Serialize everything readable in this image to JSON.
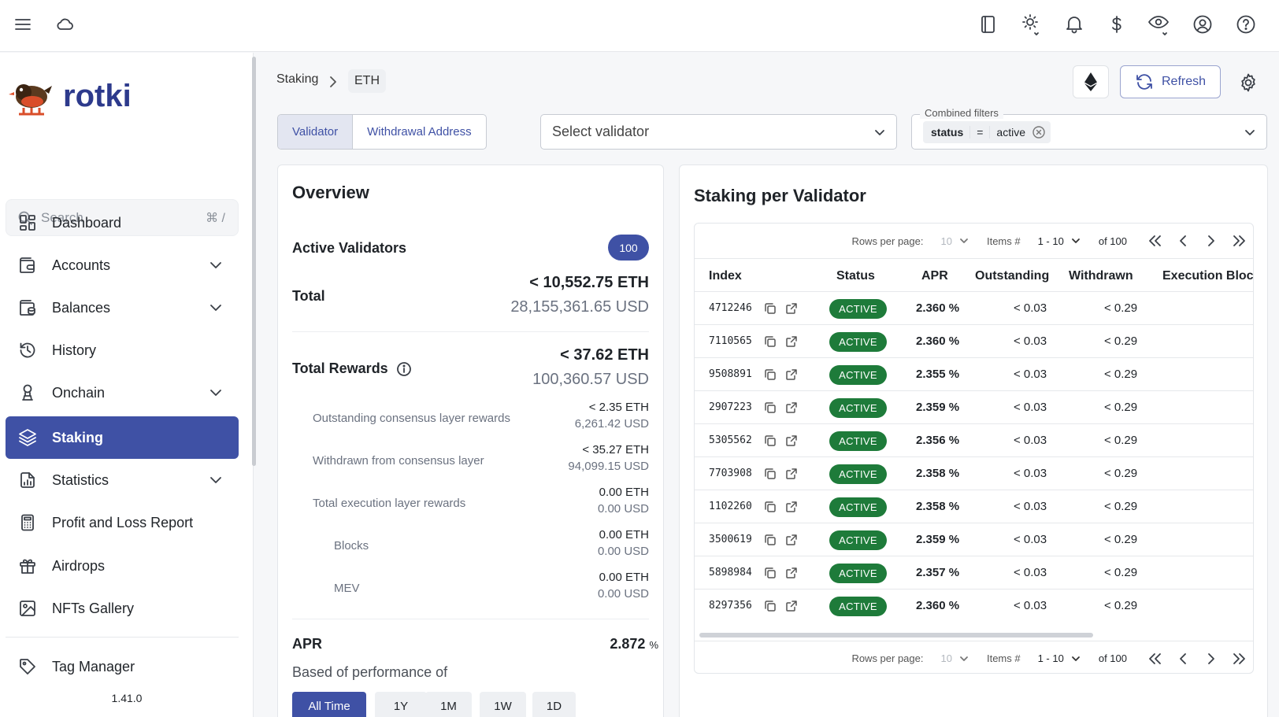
{
  "topbar": {
    "icons": [
      "menu-icon",
      "cloud-icon",
      "notes-icon",
      "theme-icon",
      "bell-icon",
      "dollar-icon",
      "eye-icon",
      "account-icon",
      "help-icon"
    ]
  },
  "sidebar": {
    "logo_text": "rotki",
    "search_placeholder": "Search",
    "search_shortcut": "⌘ /",
    "items": [
      {
        "label": "Dashboard",
        "icon": "dashboard-icon",
        "expandable": false
      },
      {
        "label": "Accounts",
        "icon": "wallet-icon",
        "expandable": true
      },
      {
        "label": "Balances",
        "icon": "balances-icon",
        "expandable": true
      },
      {
        "label": "History",
        "icon": "history-icon",
        "expandable": false
      },
      {
        "label": "Onchain",
        "icon": "onchain-icon",
        "expandable": true
      },
      {
        "label": "Staking",
        "icon": "stack-icon",
        "expandable": false,
        "active": true
      },
      {
        "label": "Statistics",
        "icon": "statistics-icon",
        "expandable": true
      },
      {
        "label": "Profit and Loss Report",
        "icon": "calculator-icon",
        "expandable": false
      },
      {
        "label": "Airdrops",
        "icon": "gift-icon",
        "expandable": false
      },
      {
        "label": "NFTs Gallery",
        "icon": "image-icon",
        "expandable": false
      }
    ],
    "tag_manager": "Tag Manager",
    "version": "1.41.0"
  },
  "header": {
    "breadcrumb": [
      "Staking",
      "ETH"
    ],
    "refresh_label": "Refresh"
  },
  "filters": {
    "toggle": [
      "Validator",
      "Withdrawal Address"
    ],
    "select_validator_placeholder": "Select validator",
    "combined_label": "Combined filters",
    "chip_key": "status",
    "chip_op": "=",
    "chip_value": "active"
  },
  "overview": {
    "title": "Overview",
    "active_validators_label": "Active Validators",
    "active_validators_count": "100",
    "total_label": "Total",
    "total_eth": "< 10,552.75 ETH",
    "total_usd": "28,155,361.65 USD",
    "rewards_label": "Total Rewards",
    "rewards_eth": "< 37.62 ETH",
    "rewards_usd": "100,360.57 USD",
    "breakdown": [
      {
        "label": "Outstanding consensus layer rewards",
        "eth": "< 2.35 ETH",
        "usd": "6,261.42 USD",
        "indent": 1
      },
      {
        "label": "Withdrawn from consensus layer",
        "eth": "< 35.27 ETH",
        "usd": "94,099.15 USD",
        "indent": 1
      },
      {
        "label": "Total execution layer rewards",
        "eth": "0.00 ETH",
        "usd": "0.00 USD",
        "indent": 1
      },
      {
        "label": "Blocks",
        "eth": "0.00 ETH",
        "usd": "0.00 USD",
        "indent": 2
      },
      {
        "label": "MEV",
        "eth": "0.00 ETH",
        "usd": "0.00 USD",
        "indent": 2
      }
    ],
    "apr_label": "APR",
    "apr_value": "2.872",
    "apr_unit": "%",
    "performance_label": "Based of performance of",
    "periods": [
      "All Time",
      "1Y",
      "1M",
      "1W",
      "1D"
    ],
    "selected_period": "All Time"
  },
  "validators": {
    "title": "Staking per Validator",
    "pager": {
      "rows_label": "Rows per page:",
      "rows_value": "10",
      "items_label": "Items #",
      "range": "1 - 10",
      "of_total": "of 100"
    },
    "columns": [
      "Index",
      "Status",
      "APR",
      "Outstanding",
      "Withdrawn",
      "Execution Block"
    ],
    "rows": [
      {
        "index": "4712246",
        "status": "ACTIVE",
        "apr": "2.360 %",
        "outstanding": "< 0.03",
        "withdrawn": "< 0.29"
      },
      {
        "index": "7110565",
        "status": "ACTIVE",
        "apr": "2.360 %",
        "outstanding": "< 0.03",
        "withdrawn": "< 0.29"
      },
      {
        "index": "9508891",
        "status": "ACTIVE",
        "apr": "2.355 %",
        "outstanding": "< 0.03",
        "withdrawn": "< 0.29"
      },
      {
        "index": "2907223",
        "status": "ACTIVE",
        "apr": "2.359 %",
        "outstanding": "< 0.03",
        "withdrawn": "< 0.29"
      },
      {
        "index": "5305562",
        "status": "ACTIVE",
        "apr": "2.356 %",
        "outstanding": "< 0.03",
        "withdrawn": "< 0.29"
      },
      {
        "index": "7703908",
        "status": "ACTIVE",
        "apr": "2.358 %",
        "outstanding": "< 0.03",
        "withdrawn": "< 0.29"
      },
      {
        "index": "1102260",
        "status": "ACTIVE",
        "apr": "2.358 %",
        "outstanding": "< 0.03",
        "withdrawn": "< 0.29"
      },
      {
        "index": "3500619",
        "status": "ACTIVE",
        "apr": "2.359 %",
        "outstanding": "< 0.03",
        "withdrawn": "< 0.29"
      },
      {
        "index": "5898984",
        "status": "ACTIVE",
        "apr": "2.357 %",
        "outstanding": "< 0.03",
        "withdrawn": "< 0.29"
      },
      {
        "index": "8297356",
        "status": "ACTIVE",
        "apr": "2.360 %",
        "outstanding": "< 0.03",
        "withdrawn": "< 0.29"
      }
    ]
  },
  "colors": {
    "accent": "#3f51a5",
    "active_status": "#1e7b3a"
  }
}
